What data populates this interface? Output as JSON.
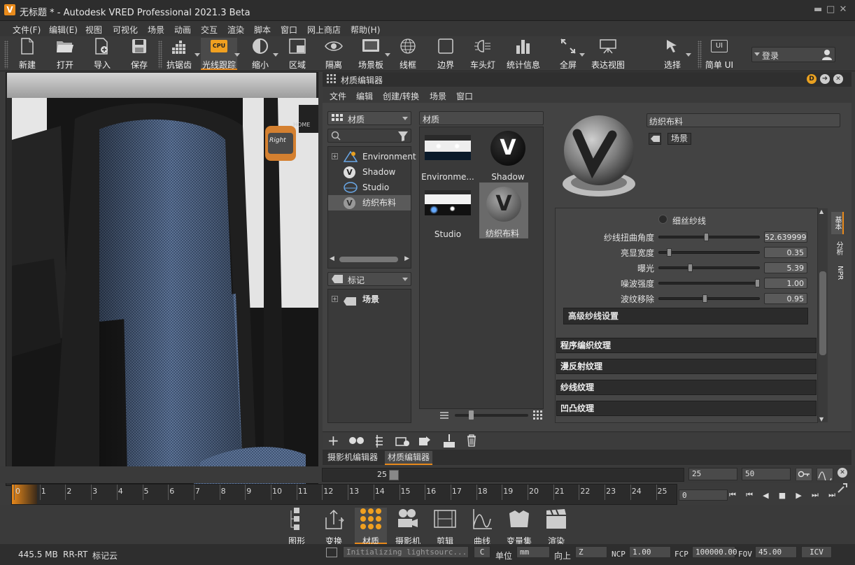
{
  "window": {
    "title": "无标题 * - Autodesk VRED Professional 2021.3 Beta",
    "logo": "V",
    "minimize": "▬",
    "maximize": "□",
    "close": "✕"
  },
  "menu": [
    "文件(F)",
    "编辑(E)",
    "视图",
    "可视化",
    "场景",
    "动画",
    "交互",
    "渲染",
    "脚本",
    "窗口",
    "网上商店",
    "帮助(H)"
  ],
  "toolbar": {
    "new": "新建",
    "open": "打开",
    "import": "导入",
    "save": "保存",
    "antialias": "抗锯齿",
    "raytrace": "光线跟踪",
    "raytrace_badge": "CPU",
    "zoom": "缩小",
    "region": "区域",
    "isolate": "隔离",
    "scene_plate": "场景板",
    "wireframe": "线框",
    "bounds": "边界",
    "headlight": "车头灯",
    "stats": "统计信息",
    "fullscreen": "全屏",
    "presentation": "表达视图",
    "select": "选择",
    "simple_ui": "简单 UI",
    "simple_ui_badge": "UI",
    "login": "登录"
  },
  "viewport": {
    "nav_cube_label": "Right",
    "home_label": "HOME"
  },
  "material_editor": {
    "title": "材质编辑器",
    "menu": [
      "文件",
      "编辑",
      "创建/转换",
      "场景",
      "窗口"
    ],
    "left_combo": "材质",
    "search_placeholder": "",
    "tree": [
      "Environment",
      "Shadow",
      "Studio",
      "纺织布料"
    ],
    "tags_combo": "标记",
    "tags_tree": [
      "场景"
    ],
    "thumbs_header": "材质",
    "thumbs": [
      "Environme...",
      "Shadow",
      "Studio",
      "纺织布料"
    ],
    "preview_name": "纺织布料",
    "scene_tag": "场景",
    "radio_label": "细丝纱线",
    "properties": [
      {
        "label": "纱线扭曲角度",
        "value": "52.639999",
        "level": 0.47
      },
      {
        "label": "亮显宽度",
        "value": "0.35",
        "level": 0.08
      },
      {
        "label": "曝光",
        "value": "5.39",
        "level": 0.3
      },
      {
        "label": "噪波强度",
        "value": "1.00",
        "level": 1.0
      },
      {
        "label": "波纹移除",
        "value": "0.95",
        "level": 0.45
      }
    ],
    "advanced": "高级纱线设置",
    "sections": [
      "程序编织纹理",
      "漫反射纹理",
      "纱线纹理",
      "凹凸纹理"
    ],
    "side_tabs": [
      "基本",
      "分析",
      "NPR"
    ],
    "bottom_tabs": [
      "摄影机编辑器",
      "材质编辑器"
    ]
  },
  "timeline": {
    "current_frame": "25",
    "start_field": "25",
    "end_field": "50",
    "ticks": [
      "0",
      "1",
      "2",
      "3",
      "4",
      "5",
      "6",
      "7",
      "8",
      "9",
      "10",
      "11",
      "12",
      "13",
      "14",
      "15",
      "16",
      "17",
      "18",
      "19",
      "20",
      "21",
      "22",
      "23",
      "24",
      "25"
    ],
    "frame_field": "0"
  },
  "modules": [
    "图形",
    "变换",
    "材质",
    "摄影机",
    "剪辑",
    "曲线",
    "变量集",
    "渲染"
  ],
  "status": {
    "memory": "445.5 MB",
    "mode": "RR-RT",
    "cloud": "标记云",
    "log": "Initializing lightsourc...",
    "c_label": "C",
    "unit_label": "单位",
    "unit": "mm",
    "up_label": "向上",
    "up": "Z",
    "ncp_label": "NCP",
    "ncp": "1.00",
    "fcp_label": "FCP",
    "fcp": "100000.00",
    "fov_label": "FOV",
    "fov": "45.00",
    "icv": "ICV"
  },
  "colors": {
    "accent": "#e8891b",
    "bg": "#3b3b3b",
    "fabric": "#4a5e7c"
  }
}
